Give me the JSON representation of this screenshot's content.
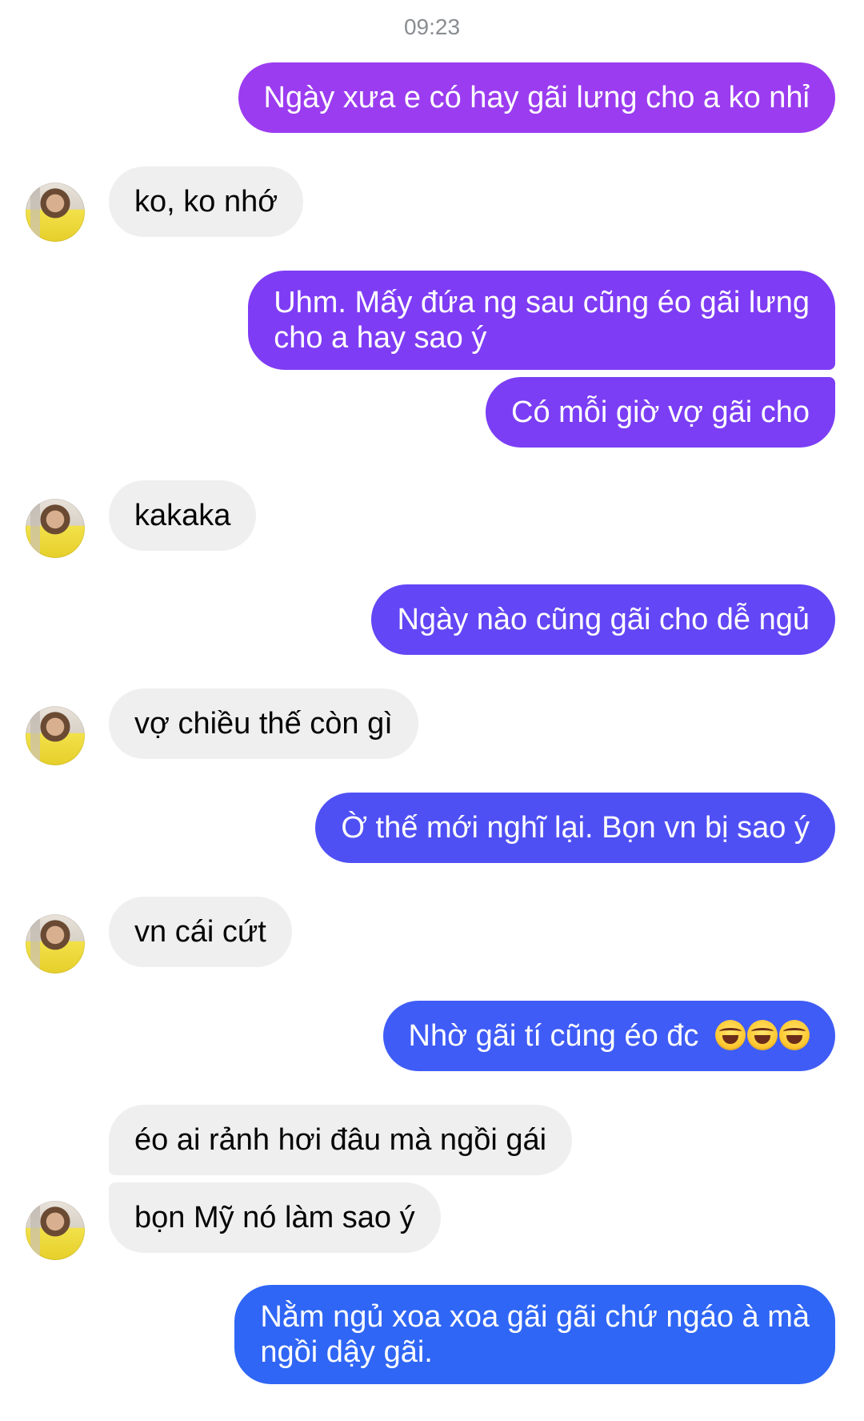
{
  "conversation": {
    "timestamp": "09:23",
    "messages": [
      {
        "text": "Ngày xưa e có hay gãi lưng cho a ko nhỉ",
        "color": "#9b3cf0"
      },
      {
        "text": "ko, ko nhớ"
      },
      {
        "line1": "Uhm. Mấy đứa ng sau cũng éo gãi lưng",
        "line2": "cho a hay sao ý",
        "color": "#7f3cf5"
      },
      {
        "text": "Có mỗi giờ vợ gãi cho",
        "color": "#7b3ef5"
      },
      {
        "text": "kakaka"
      },
      {
        "text": "Ngày nào cũng gãi cho dễ ngủ",
        "color": "#6346f5"
      },
      {
        "text": "vợ chiều thế còn gì"
      },
      {
        "text": "Ờ thế mới nghĩ lại. Bọn vn bị sao ý",
        "color": "#4f50f4"
      },
      {
        "text": "vn cái cứt"
      },
      {
        "text": "Nhờ gãi tí cũng éo đc",
        "emojis": [
          "face-with-tears-of-joy",
          "face-with-tears-of-joy",
          "face-with-tears-of-joy"
        ],
        "color": "#3f5cf6"
      },
      {
        "text": "éo ai rảnh hơi đâu mà ngồi gái"
      },
      {
        "text": "bọn Mỹ nó làm sao ý"
      },
      {
        "line1": "Nằm ngủ xoa xoa gãi gãi chứ ngáo à mà",
        "line2": "ngồi dậy gãi.",
        "color": "#2f66f5"
      }
    ]
  },
  "avatar": {
    "name": "contact-avatar"
  },
  "colors": {
    "incoming_bg": "#efefef",
    "incoming_text": "#050505"
  }
}
